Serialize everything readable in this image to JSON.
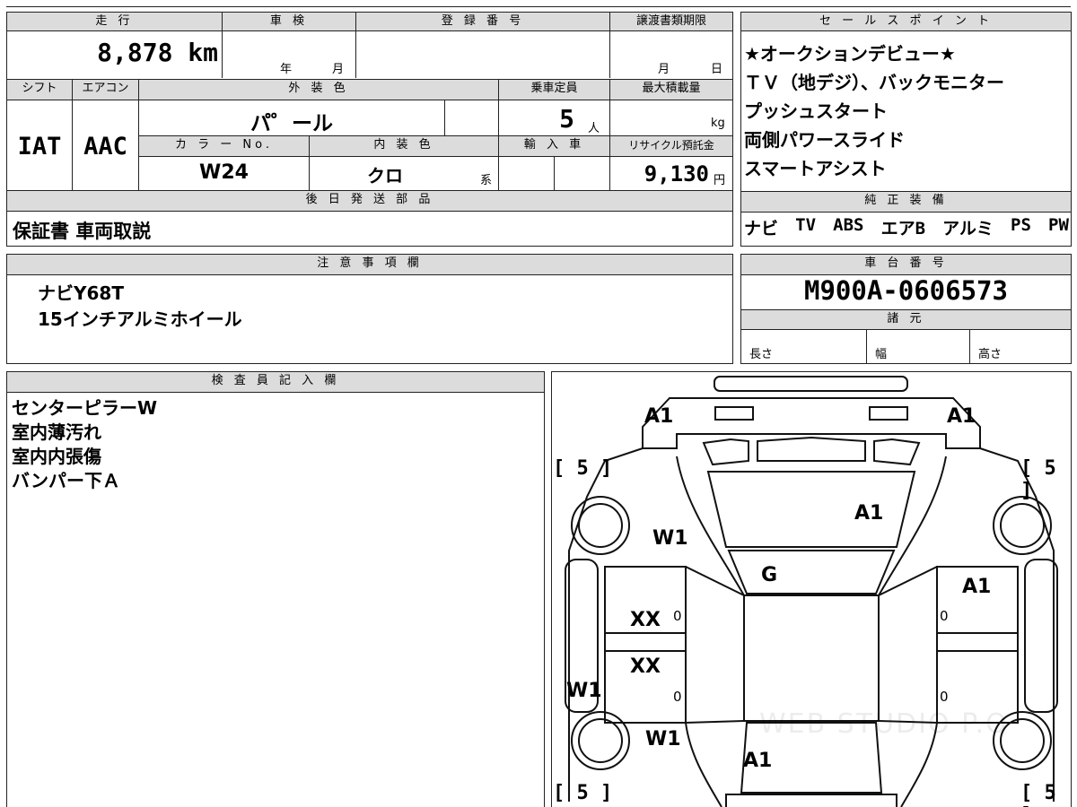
{
  "top_sheet": {
    "mileage_header": "走 行",
    "mileage_value": "8,878 km",
    "inspection_header": "車 検",
    "inspection_year": "年",
    "inspection_month": "月",
    "reg_header": "登 録 番 号",
    "reg_value": "",
    "transfer_header": "譲渡書類期限",
    "transfer_month": "月",
    "transfer_day": "日",
    "shift_header": "シフト",
    "shift_value": "IAT",
    "ac_header": "エアコン",
    "ac_value": "AAC",
    "exterior_header": "外 装 色",
    "exterior_value": "パ゜ール",
    "capacity_header": "乗車定員",
    "capacity_value": "5",
    "capacity_unit": "人",
    "load_header": "最大積載量",
    "load_unit": "kg",
    "color_no_header": "カ ラ ー No.",
    "color_no_value": "W24",
    "interior_header": "内 装 色",
    "interior_value": "クロ",
    "interior_suffix": "系",
    "import_header": "輸 入 車",
    "recycle_header": "リサイクル預託金",
    "recycle_value": "9,130",
    "recycle_unit": "円",
    "later_parts_header": "後 日 発 送 部 品",
    "later_parts_value": "保証書 車両取説"
  },
  "sales_points": {
    "header": "セ ー ル ス ポ イ ン ト",
    "lines": [
      "★オークションデビュー★",
      "ＴＶ（地デジ）、バックモニター",
      "プッシュスタート",
      "両側パワースライド",
      "スマートアシスト"
    ]
  },
  "genuine_equipment": {
    "header": "純 正 装 備",
    "items": [
      "ナビ",
      "TV",
      "ABS",
      "エアB",
      "アルミ",
      "PS",
      "PW"
    ]
  },
  "notes": {
    "header": "注 意 事 項 欄",
    "lines": [
      "ナビY68T",
      "15インチアルミホイール"
    ]
  },
  "chassis": {
    "header": "車 台 番 号",
    "value": "M900A-0606573",
    "specs_header": "諸 元",
    "length_label": "長さ",
    "width_label": "幅",
    "height_label": "高さ"
  },
  "inspector": {
    "header": "検 査 員 記 入 欄",
    "lines": [
      "センターピラーW",
      "室内薄汚れ",
      "室内内張傷",
      "バンパー下Ａ"
    ]
  },
  "diagram": {
    "labels": {
      "front_left": "A1",
      "front_right": "A1",
      "bonnet": "A1",
      "left_fender": "W1",
      "windshield": "G",
      "right_front_door": "A1",
      "left_front_door": "XX",
      "left_rear_door": "XX",
      "left_rocker": "W1",
      "left_rear_fender": "W1",
      "roof_rear": "A1"
    },
    "tire_ratings": [
      "5",
      "5",
      "5",
      "5"
    ],
    "zero_marks": [
      "0",
      "0",
      "0",
      "0"
    ],
    "watermark": "WEB STUDIO P.O"
  }
}
